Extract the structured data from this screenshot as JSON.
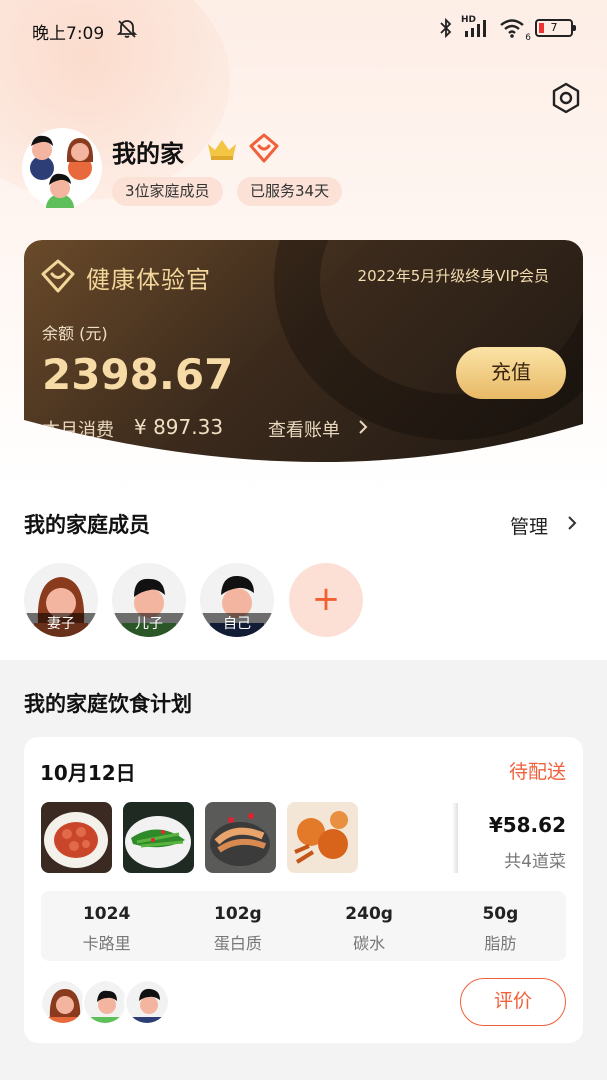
{
  "status_bar": {
    "time": "晚上7:09",
    "network": "HD",
    "wifi_badge": "6",
    "battery": "7"
  },
  "family": {
    "title": "我的家",
    "members_pill": "3位家庭成员",
    "served_pill": "已服务34天"
  },
  "vip_card": {
    "brand": "健康体验官",
    "vip_text": "2022年5月升级终身VIP会员",
    "balance_label": "余额 (元)",
    "balance": "2398.67",
    "month_label": "本月消费",
    "month_value": "¥ 897.33",
    "bill_link": "查看账单",
    "recharge": "充值"
  },
  "members_section": {
    "title": "我的家庭成员",
    "manage": "管理",
    "members": [
      {
        "label": "妻子",
        "icon": "woman-avatar"
      },
      {
        "label": "儿子",
        "icon": "boy-avatar"
      },
      {
        "label": "自己",
        "icon": "man-avatar"
      }
    ],
    "add": "+"
  },
  "plan_section": {
    "title": "我的家庭饮食计划",
    "date": "10月12日",
    "status": "待配送",
    "price": "¥58.62",
    "dish_count": "共4道菜",
    "dishes": [
      "sausage-dish",
      "vegetable-dish",
      "shrimp-dish",
      "crab-dish"
    ],
    "nutrition": [
      {
        "value": "1024",
        "label": "卡路里"
      },
      {
        "value": "102g",
        "label": "蛋白质"
      },
      {
        "value": "240g",
        "label": "碳水"
      },
      {
        "value": "50g",
        "label": "脂肪"
      }
    ],
    "rate": "评价"
  },
  "colors": {
    "accent": "#f0603a",
    "gold": "#f3d79a",
    "card_dark": "#2a1f16"
  }
}
